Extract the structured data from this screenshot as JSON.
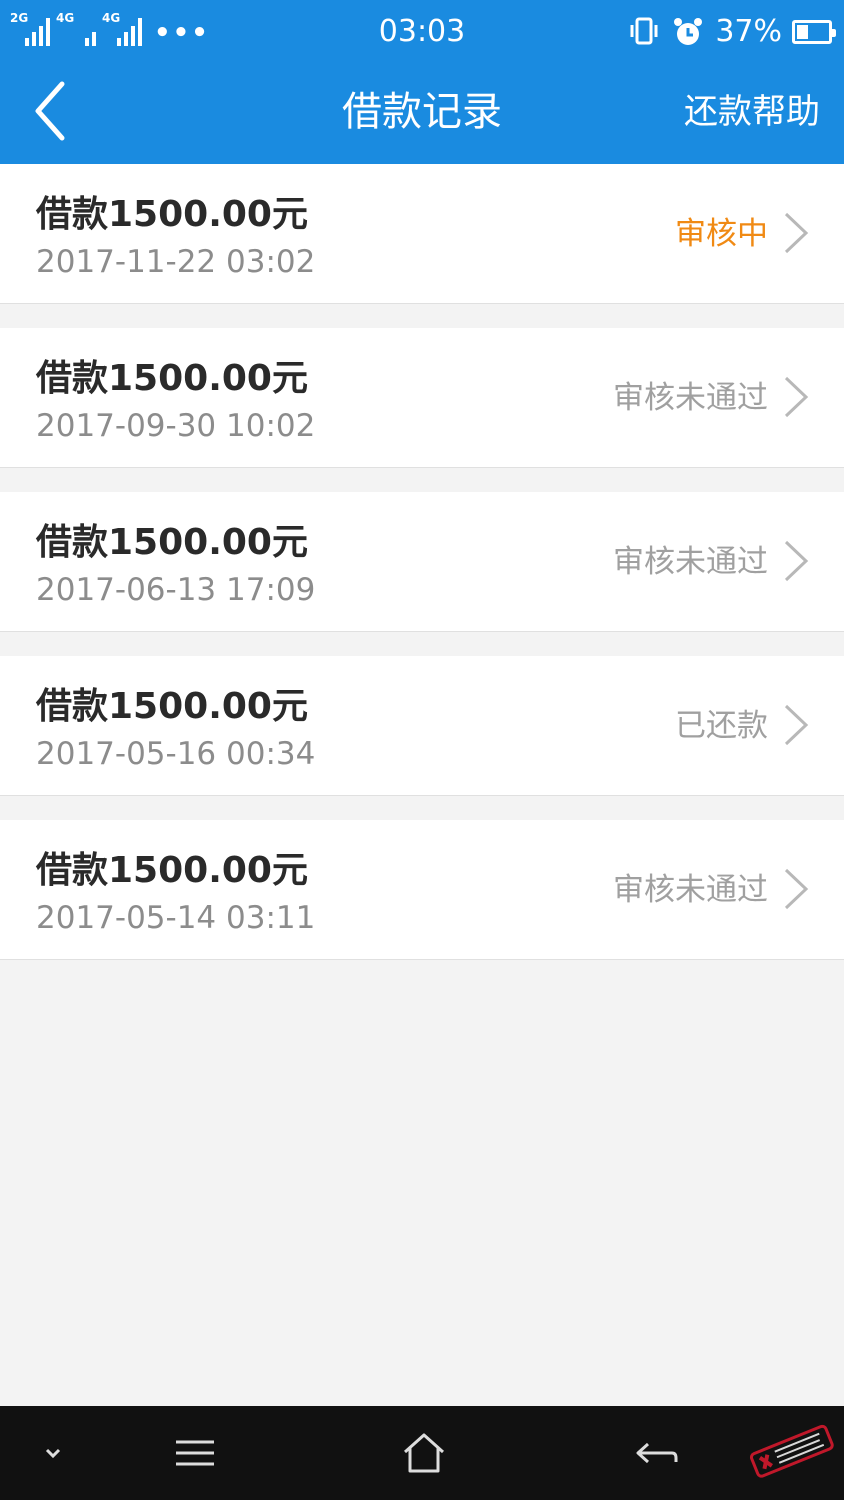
{
  "status_bar": {
    "signal1_tag": "2G",
    "signal2_tag": "4G",
    "signal3_tag": "4G",
    "dots": "•••",
    "time": "03:03",
    "battery_percent": "37%",
    "battery_level": 0.37
  },
  "nav": {
    "back_icon": "chevron-left-icon",
    "title": "借款记录",
    "help_label": "还款帮助"
  },
  "records": [
    {
      "title": "借款1500.00元",
      "date": "2017-11-22 03:02",
      "status": "审核中",
      "status_color": "#f08a14"
    },
    {
      "title": "借款1500.00元",
      "date": "2017-09-30 10:02",
      "status": "审核未通过",
      "status_color": "#a0a0a0"
    },
    {
      "title": "借款1500.00元",
      "date": "2017-06-13 17:09",
      "status": "审核未通过",
      "status_color": "#a0a0a0"
    },
    {
      "title": "借款1500.00元",
      "date": "2017-05-16 00:34",
      "status": "已还款",
      "status_color": "#a0a0a0"
    },
    {
      "title": "借款1500.00元",
      "date": "2017-05-14 03:11",
      "status": "审核未通过",
      "status_color": "#a0a0a0"
    }
  ],
  "bottom_nav": {
    "icons": [
      "chevron-down-icon",
      "menu-icon",
      "home-icon",
      "back-arrow-icon"
    ]
  },
  "colors": {
    "header_bg": "#1a8be0",
    "pending": "#f08a14"
  }
}
